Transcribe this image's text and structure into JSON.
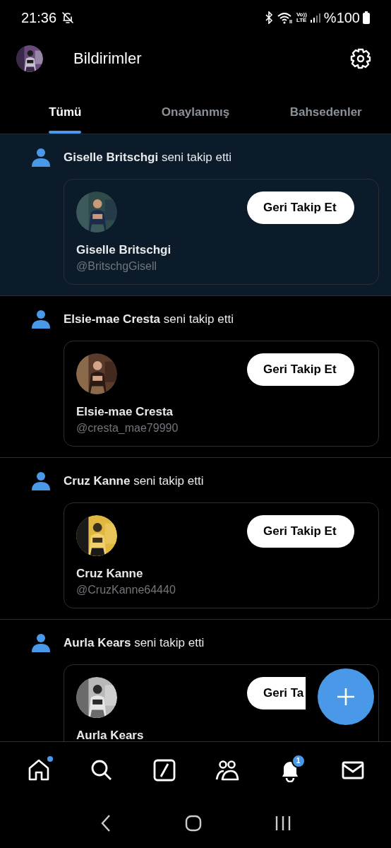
{
  "status_bar": {
    "time": "21:36",
    "volte_top": "Vo))",
    "volte_bottom": "LTE",
    "battery": "%100"
  },
  "header": {
    "title": "Bildirimler"
  },
  "tabs": [
    {
      "label": "Tümü",
      "selected": true
    },
    {
      "label": "Onaylanmış",
      "selected": false
    },
    {
      "label": "Bahsedenler",
      "selected": false
    }
  ],
  "notifications": [
    {
      "text": "**Giselle Britschgi** seni takip etti",
      "unread": true,
      "name": "Giselle Britschgi",
      "handle": "@BritschgGisell",
      "button": "Geri Takip Et"
    },
    {
      "text": "**Elsie-mae Cresta** seni takip etti",
      "unread": false,
      "name": "Elsie-mae Cresta",
      "handle": "@cresta_mae79990",
      "button": "Geri Takip Et"
    },
    {
      "text": "**Cruz Kanne** seni takip etti",
      "unread": false,
      "name": "Cruz Kanne",
      "handle": "@CruzKanne64440",
      "button": "Geri Takip Et"
    },
    {
      "text": "**Aurla Kears** seni takip etti",
      "unread": false,
      "name": "Aurla Kears",
      "button": "Geri Ta"
    }
  ],
  "nav": [
    {
      "kind": "home",
      "dot": true
    },
    {
      "kind": "search",
      "dot": false
    },
    {
      "kind": "compose",
      "dot": false
    },
    {
      "kind": "communities",
      "dot": false
    },
    {
      "kind": "notifications",
      "dot": false,
      "badge": "1"
    },
    {
      "kind": "messages",
      "dot": false
    }
  ]
}
